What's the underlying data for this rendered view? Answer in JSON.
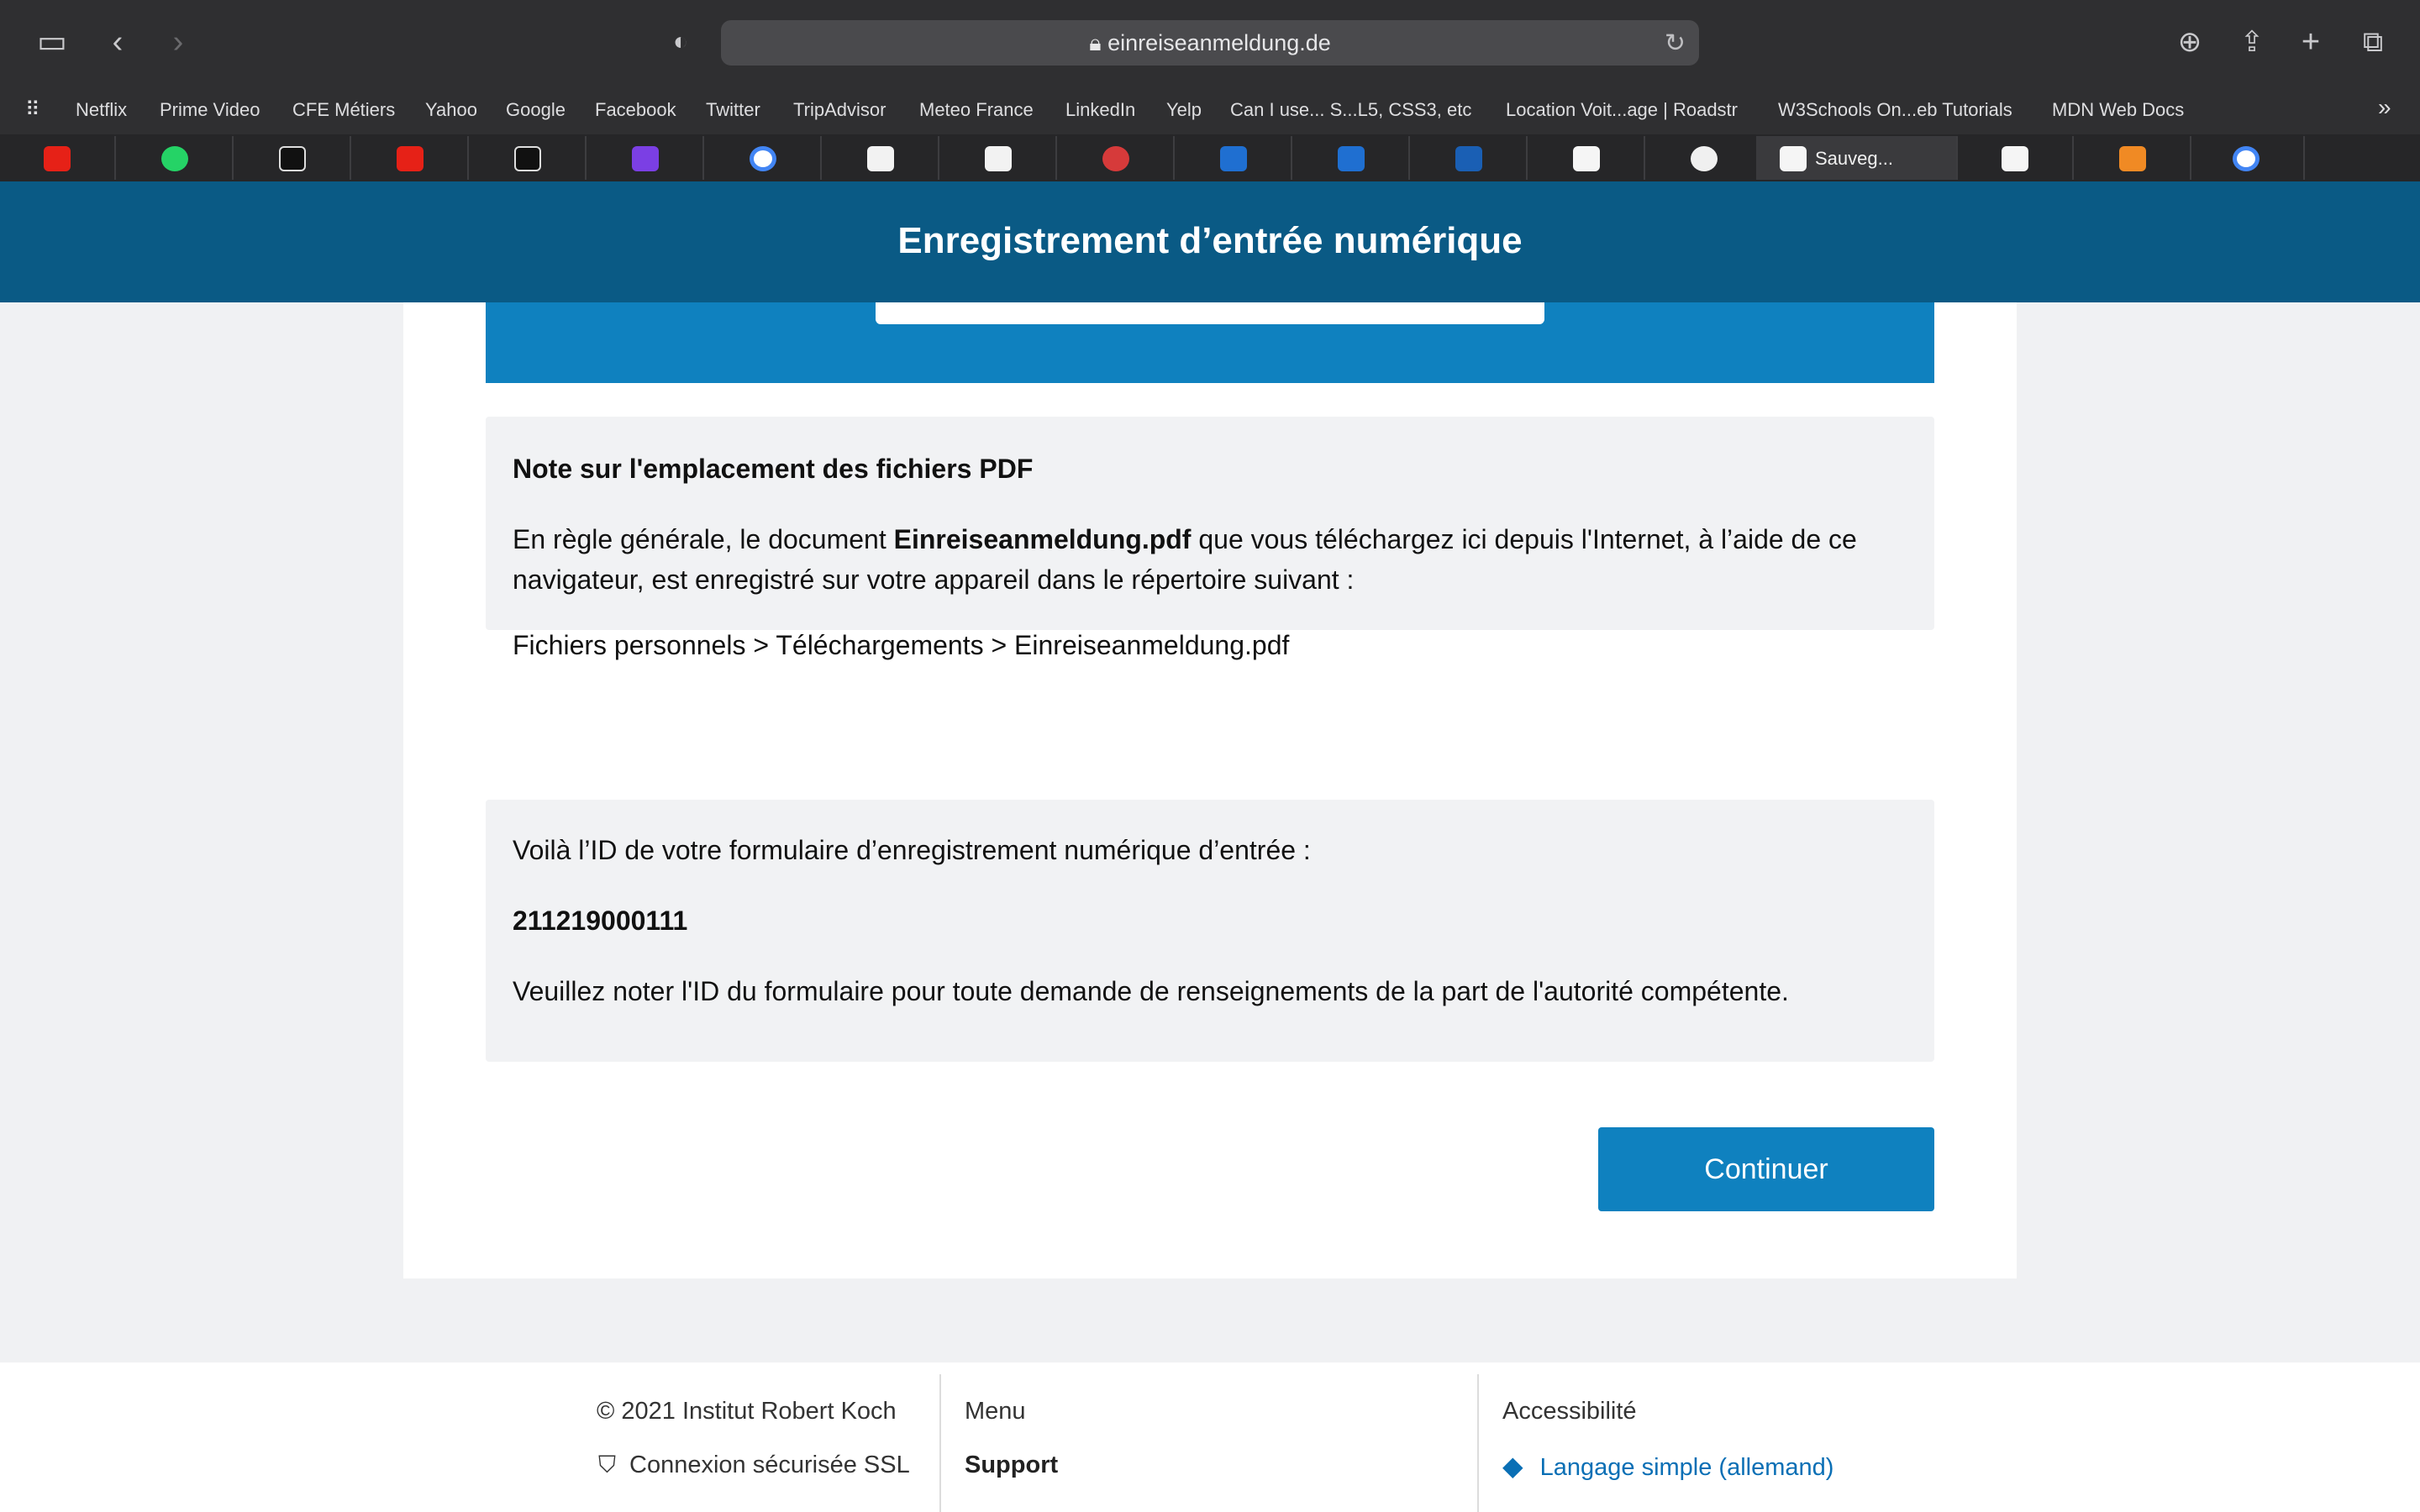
{
  "browser": {
    "url": "einreiseanmeldung.de",
    "bookmarks": [
      "Netflix",
      "Prime Video",
      "CFE Métiers",
      "Yahoo",
      "Google",
      "Facebook",
      "Twitter",
      "TripAdvisor",
      "Meteo France",
      "LinkedIn",
      "Yelp",
      "Can I use... S...L5, CSS3, etc",
      "Location Voit...age | Roadstr",
      "W3Schools On...eb Tutorials",
      "MDN Web Docs"
    ],
    "active_tab_label": "Sauveg..."
  },
  "site": {
    "title": "Enregistrement d’entrée numérique"
  },
  "note": {
    "title": "Note sur l'emplacement des fichiers PDF",
    "text_before": "En règle générale, le document ",
    "filename": "Einreiseanmeldung.pdf",
    "text_after": " que vous téléchargez ici depuis l'Internet, à l’aide de ce navigateur, est enregistré sur votre appareil dans le répertoire suivant :",
    "path": "Fichiers personnels > Téléchargements > Einreiseanmeldung.pdf"
  },
  "id_box": {
    "label": "Voilà l’ID de votre formulaire d’enregistrement numérique d’entrée :",
    "form_id": "211219000111",
    "instruction": "Veuillez noter l'ID du formulaire pour toute demande de renseignements de la part de l'autorité compétente."
  },
  "actions": {
    "continue_label": "Continuer"
  },
  "footer": {
    "copyright": "© 2021 Institut Robert Koch",
    "ssl": "Connexion sécurisée SSL",
    "menu_heading": "Menu",
    "support": "Support",
    "accessibility_heading": "Accessibilité",
    "simple_language": "Langage simple (allemand)"
  },
  "colors": {
    "header_bg": "#0a5a85",
    "accent": "#0f81bf",
    "panel_bg": "#f1f2f4"
  }
}
